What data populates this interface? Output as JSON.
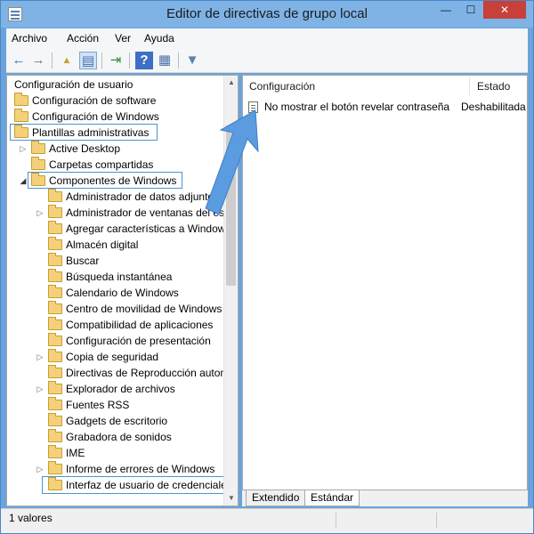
{
  "window": {
    "title": "Editor de directivas de grupo local",
    "controls": {
      "minimize": "—",
      "maximize": "☐",
      "close": "✕"
    }
  },
  "menu": [
    "Archivo",
    "Acción",
    "Ver",
    "Ayuda"
  ],
  "toolbar": {
    "back": "←",
    "forward": "→",
    "up": "▲",
    "show_tree": "▤",
    "export": "⇥",
    "help": "?",
    "properties": "▦",
    "filter": "▼"
  },
  "tree": {
    "root": "Configuración de usuario",
    "items": [
      {
        "label": "Configuración de software"
      },
      {
        "label": "Configuración de Windows"
      },
      {
        "label": "Plantillas administrativas"
      },
      {
        "label": "Active Desktop"
      },
      {
        "label": "Carpetas compartidas"
      },
      {
        "label": "Componentes de Windows"
      },
      {
        "label": "Administrador de datos adjuntos"
      },
      {
        "label": "Administrador de ventanas del escritorio"
      },
      {
        "label": "Agregar características a Windows"
      },
      {
        "label": "Almacén digital"
      },
      {
        "label": "Buscar"
      },
      {
        "label": "Búsqueda instantánea"
      },
      {
        "label": "Calendario de Windows"
      },
      {
        "label": "Centro de movilidad de Windows"
      },
      {
        "label": "Compatibilidad de aplicaciones"
      },
      {
        "label": "Configuración de presentación"
      },
      {
        "label": "Copia de seguridad"
      },
      {
        "label": "Directivas de Reproducción automática"
      },
      {
        "label": "Explorador de archivos"
      },
      {
        "label": "Fuentes RSS"
      },
      {
        "label": "Gadgets de escritorio"
      },
      {
        "label": "Grabadora de sonidos"
      },
      {
        "label": "IME"
      },
      {
        "label": "Informe de errores de Windows"
      },
      {
        "label": "Interfaz de usuario de credenciales"
      }
    ]
  },
  "list": {
    "columns": [
      "Configuración",
      "Estado"
    ],
    "rows": [
      {
        "name": "No mostrar el botón revelar contraseña",
        "state": "Deshabilitada"
      }
    ]
  },
  "tabs": [
    "Extendido",
    "Estándar"
  ],
  "status": {
    "text": "1 valores"
  },
  "colors": {
    "highlight": "#4a94d6",
    "arrow": "#5b9be0",
    "titlebar": "#7fb3e6",
    "close": "#c7403a"
  }
}
